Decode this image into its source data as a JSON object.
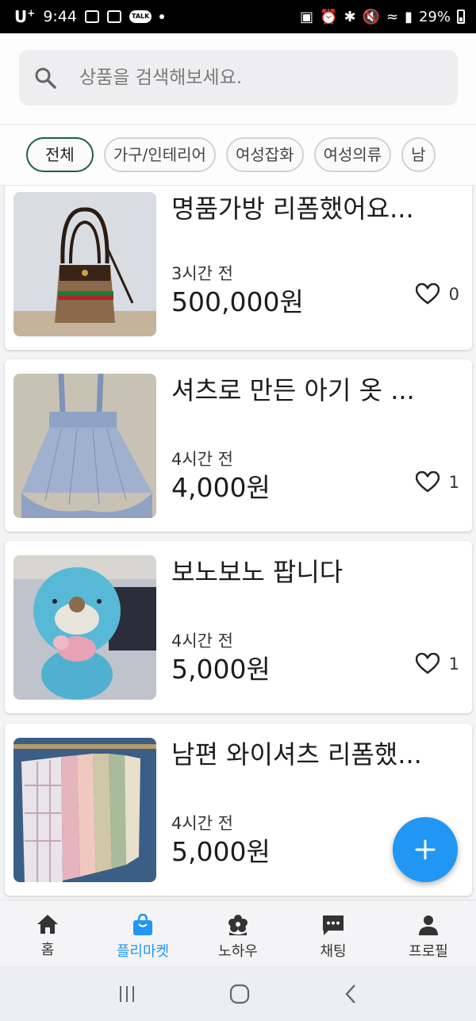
{
  "status_bar": {
    "carrier": "U",
    "carrier_sup": "+",
    "time": "9:44",
    "talk_badge": "TALK",
    "battery": "29%"
  },
  "search": {
    "placeholder": "상품을 검색해보세요.",
    "icon": "search-icon"
  },
  "categories": [
    {
      "label": "전체",
      "active": true
    },
    {
      "label": "가구/인테리어",
      "active": false
    },
    {
      "label": "여성잡화",
      "active": false
    },
    {
      "label": "여성의류",
      "active": false
    },
    {
      "label": "남",
      "active": false
    }
  ],
  "products": [
    {
      "title": "명품가방 리폼했어요...",
      "time": "3시간 전",
      "price": "500,000원",
      "likes": "0"
    },
    {
      "title": "셔츠로 만든 아기 옷 ...",
      "time": "4시간 전",
      "price": "4,000원",
      "likes": "1"
    },
    {
      "title": "보노보노 팝니다",
      "time": "4시간 전",
      "price": "5,000원",
      "likes": "1"
    },
    {
      "title": "남편 와이셔츠 리폼했...",
      "time": "4시간 전",
      "price": "5,000원",
      "likes": ""
    }
  ],
  "fab": {
    "icon": "plus-icon"
  },
  "bottom_nav": [
    {
      "label": "홈",
      "icon": "home-icon",
      "active": false
    },
    {
      "label": "플리마켓",
      "icon": "shopping-bag-icon",
      "active": true
    },
    {
      "label": "노하우",
      "icon": "flower-icon",
      "active": false
    },
    {
      "label": "채팅",
      "icon": "chat-icon",
      "active": false
    },
    {
      "label": "프로필",
      "icon": "person-icon",
      "active": false
    }
  ],
  "colors": {
    "accent": "#2196f3",
    "chip_active_border": "#1d5e46"
  }
}
